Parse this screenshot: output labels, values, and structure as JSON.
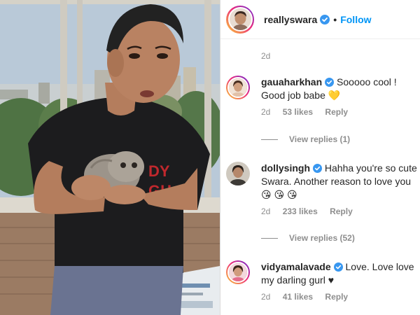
{
  "header": {
    "username": "reallyswara",
    "separator": "•",
    "follow_label": "Follow",
    "avatar_icon": "profile-avatar"
  },
  "post": {
    "timestamp": "2d"
  },
  "comments": [
    {
      "username": "gauaharkhan",
      "verified": true,
      "text": "Sooooo cool ! Good job babe 💛",
      "time": "2d",
      "likes": "53 likes",
      "reply_label": "Reply",
      "view_replies": "View replies (1)"
    },
    {
      "username": "dollysingh",
      "verified": true,
      "text": "Hahha you're so cute Swara. Another reason to love you😘 😘 😘",
      "time": "2d",
      "likes": "233 likes",
      "reply_label": "Reply",
      "view_replies": "View replies (52)"
    },
    {
      "username": "vidyamalavade",
      "verified": true,
      "text": "Love. Love love my darling gurl ♥",
      "time": "2d",
      "likes": "41 likes",
      "reply_label": "Reply"
    }
  ],
  "colors": {
    "accent": "#0095f6",
    "muted": "#8e8e8e",
    "text": "#262626",
    "shirt_print": "#c0282d"
  },
  "photo": {
    "shirt_text_line1": "DY",
    "shirt_text_line2": "GH"
  }
}
